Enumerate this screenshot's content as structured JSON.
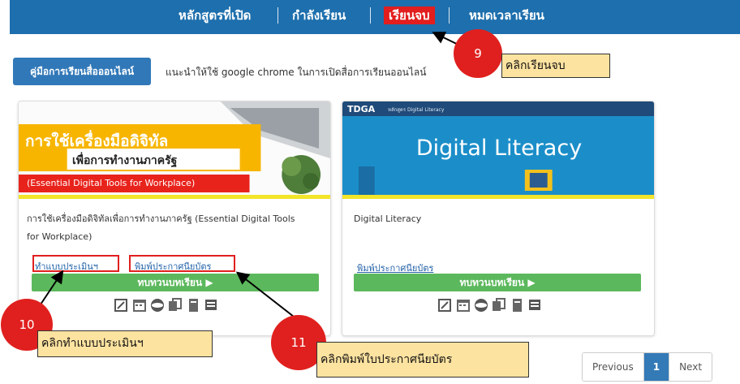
{
  "nav": {
    "items": [
      "หลักสูตรที่เปิด",
      "กำลังเรียน",
      "เรียนจบ",
      "หมดเวลาเรียน"
    ]
  },
  "guide": {
    "button_label": "คู่มือการเรียนสื่อออนไลน์",
    "hint": "แนะนำให้ใช้ google chrome ในการเปิดสื่อการเรียนออนไลน์"
  },
  "cards": [
    {
      "banner_line1": "การใช้เครื่องมือดิจิทัล",
      "banner_line2": "เพื่อการทำงานภาครัฐ",
      "banner_line3": "(Essential Digital Tools for Workplace)",
      "title": "การใช้เครื่องมือดิจิทัลเพื่อการทำงานภาครัฐ (Essential Digital Tools for Workplace)",
      "link_assess": "ทำแบบประเมินฯ",
      "link_print": "พิมพ์ประกาศนียบัตร",
      "review_button": "ทบทวนบทเรียน ▶"
    },
    {
      "brand": "TDGA",
      "brand_sub": "หลักสูตร Digital Literacy",
      "banner_title": "Digital Literacy",
      "title": "Digital Literacy",
      "link_print": "พิมพ์ประกาศนียบัตร",
      "review_button": "ทบทวนบทเรียน ▶"
    }
  ],
  "annotations": [
    {
      "number": "9",
      "text": "คลิกเรียนจบ"
    },
    {
      "number": "10",
      "text": "คลิกทำแบบประเมินฯ"
    },
    {
      "number": "11",
      "text": "คลิกพิมพ์ใบประกาศนียบัตร"
    }
  ],
  "pagination": {
    "previous": "Previous",
    "current": "1",
    "next": "Next"
  },
  "colors": {
    "nav_bg": "#1e6fad",
    "active_tab": "#e21e1e",
    "green": "#5cb85c",
    "annotation_red": "#e0201e",
    "callout_bg": "#fde3a0"
  }
}
